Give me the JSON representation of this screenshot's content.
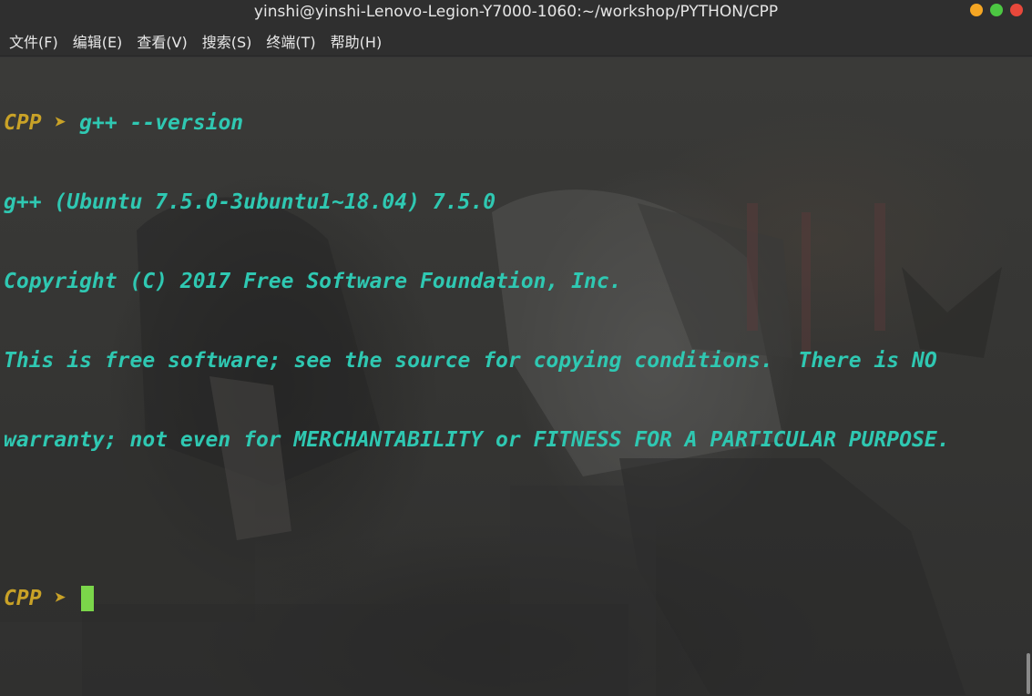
{
  "window": {
    "title": "yinshi@yinshi-Lenovo-Legion-Y7000-1060:~/workshop/PYTHON/CPP",
    "controls": [
      {
        "name": "minimize",
        "color": "#f5a623"
      },
      {
        "name": "maximize",
        "color": "#4cc742"
      },
      {
        "name": "close",
        "color": "#e8483b"
      }
    ]
  },
  "menubar": {
    "items": [
      {
        "label": "文件(F)"
      },
      {
        "label": "编辑(E)"
      },
      {
        "label": "查看(V)"
      },
      {
        "label": "搜索(S)"
      },
      {
        "label": "终端(T)"
      },
      {
        "label": "帮助(H)"
      }
    ]
  },
  "terminal": {
    "prompt_name": "CPP",
    "prompt_symbol": "➤",
    "command": "g++ --version",
    "output": [
      "g++ (Ubuntu 7.5.0-3ubuntu1~18.04) 7.5.0",
      "Copyright (C) 2017 Free Software Foundation, Inc.",
      "This is free software; see the source for copying conditions.  There is NO",
      "warranty; not even for MERCHANTABILITY or FITNESS FOR A PARTICULAR PURPOSE."
    ],
    "colors": {
      "prompt": "#c9a227",
      "output": "#2fc8b2",
      "cursor": "#7bd64a"
    }
  }
}
